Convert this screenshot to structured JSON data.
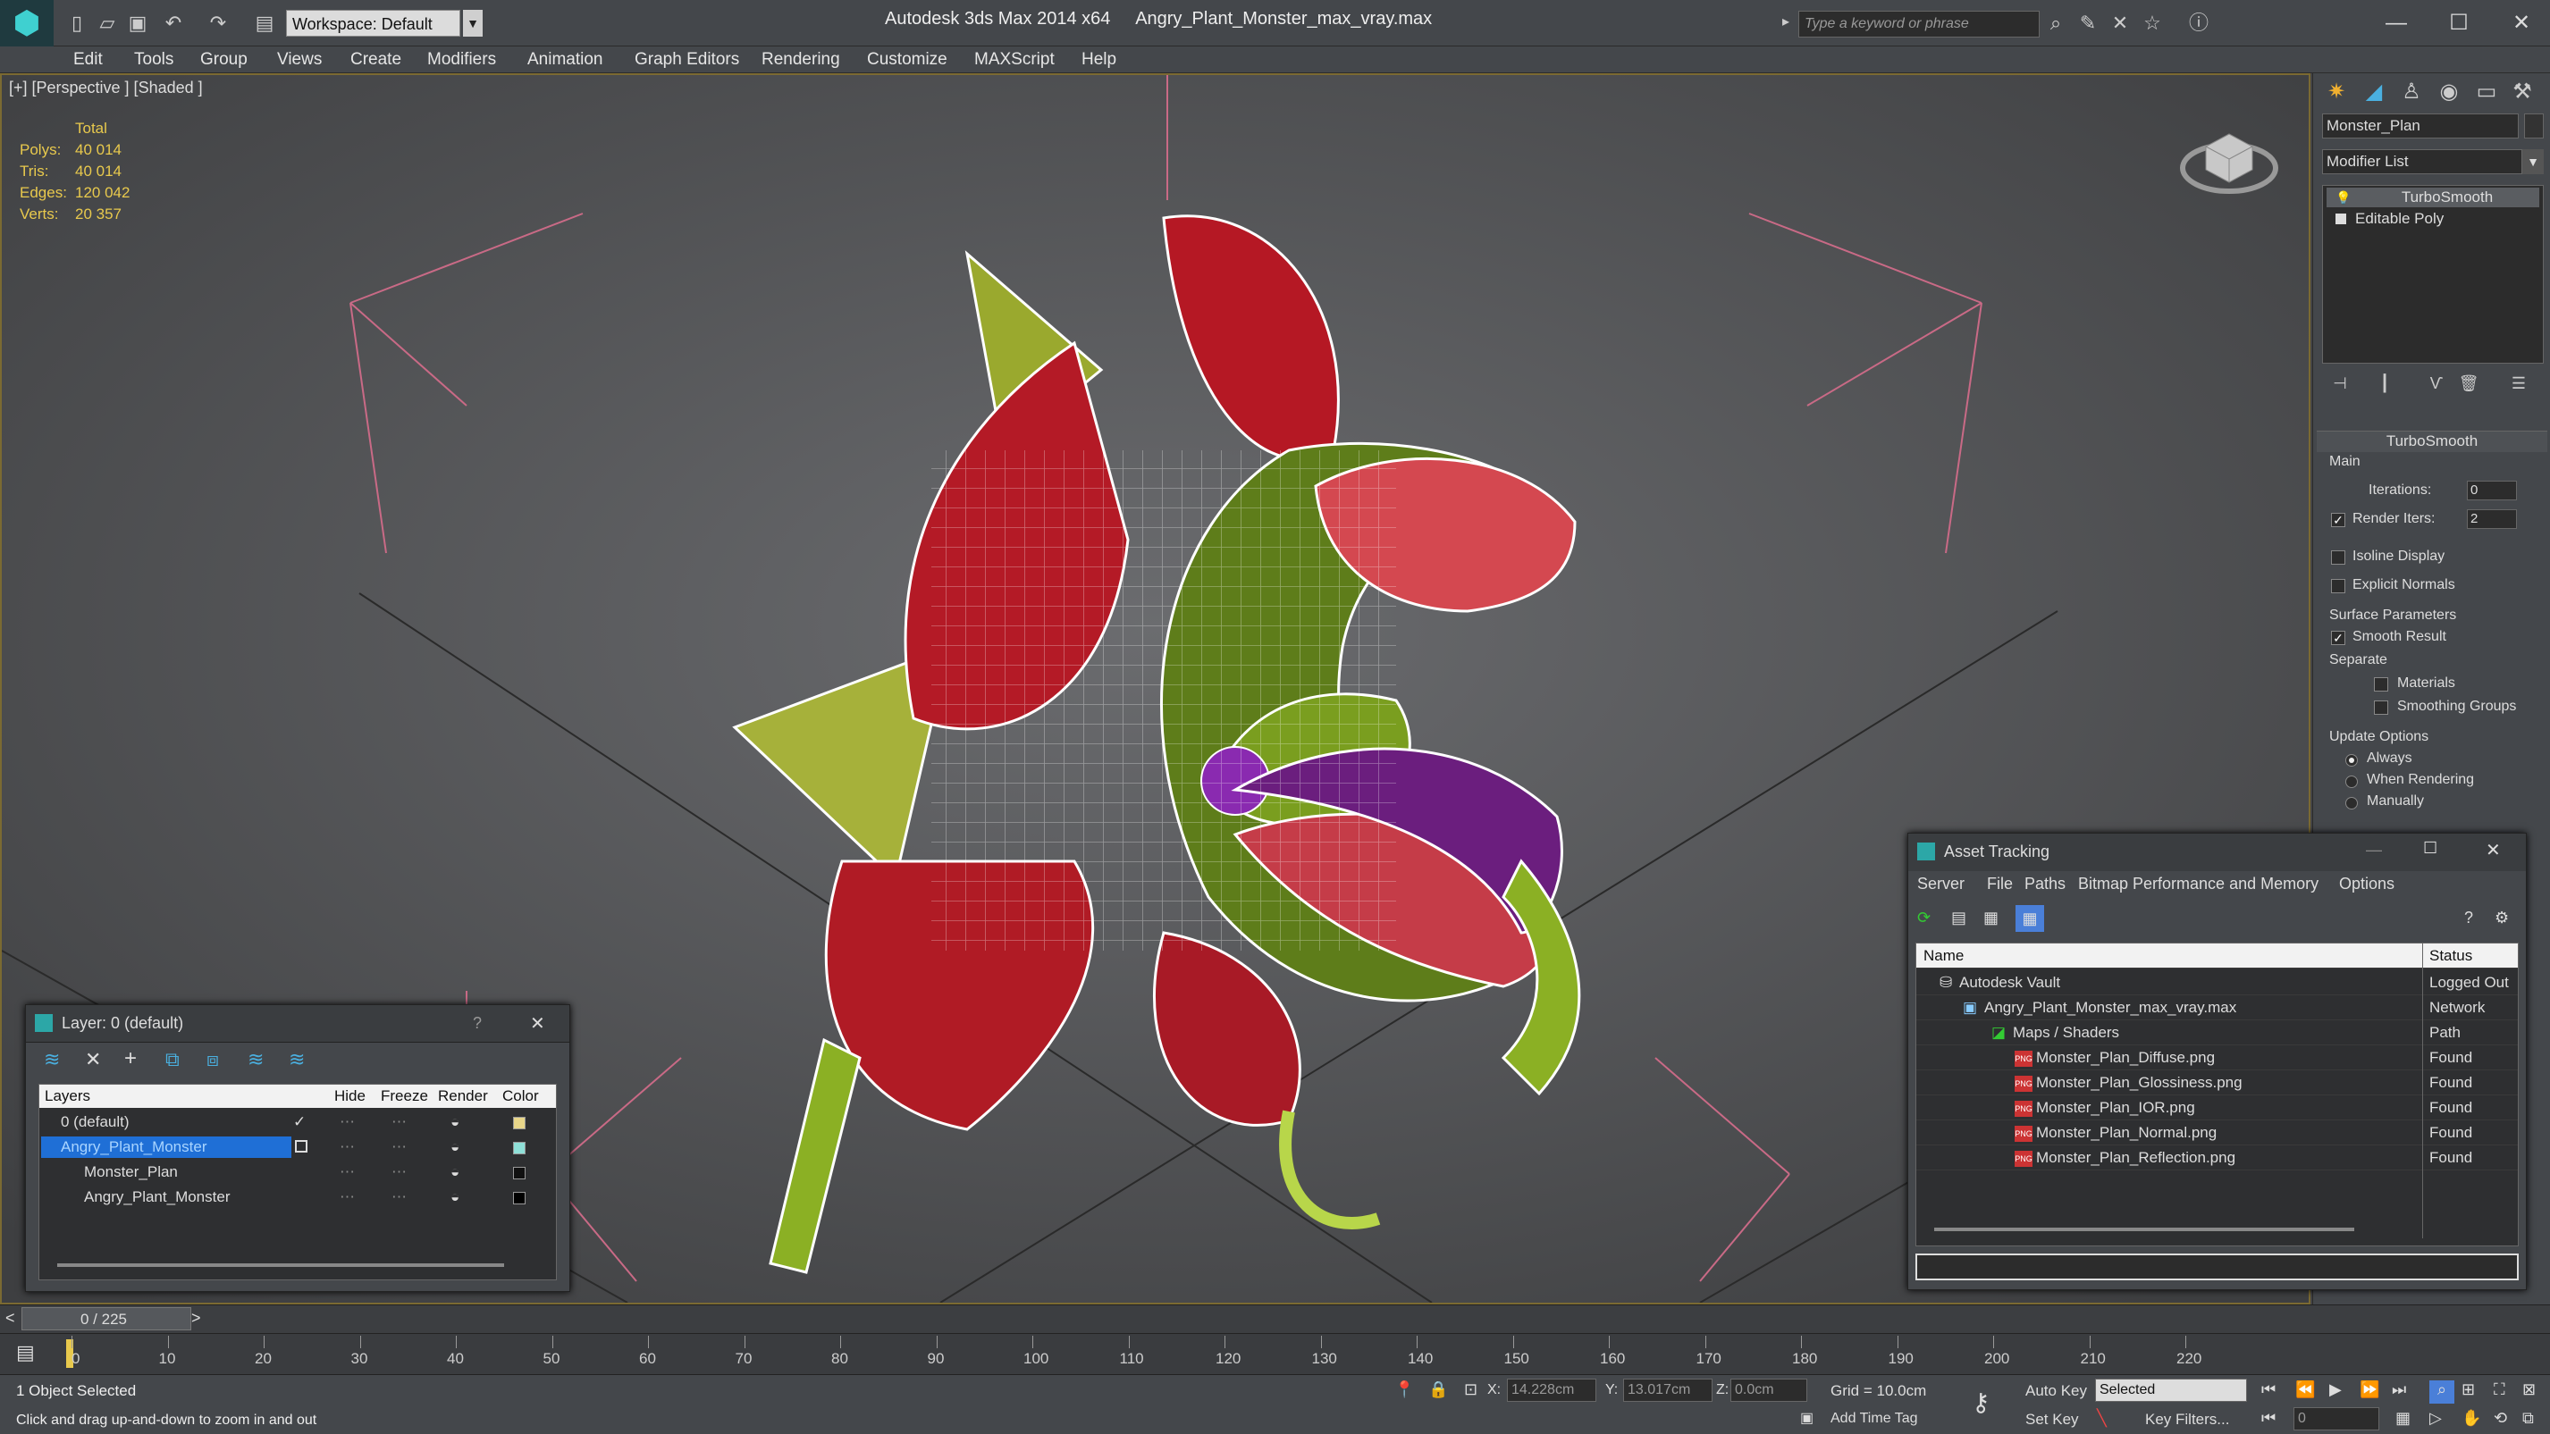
{
  "app": {
    "title": "Autodesk 3ds Max  2014 x64",
    "file": "Angry_Plant_Monster_max_vray.max",
    "workspace": "Workspace: Default",
    "search_placeholder": "Type a keyword or phrase"
  },
  "menu": [
    "Edit",
    "Tools",
    "Group",
    "Views",
    "Create",
    "Modifiers",
    "Animation",
    "Graph Editors",
    "Rendering",
    "Customize",
    "MAXScript",
    "Help"
  ],
  "viewport": {
    "label": "[+] [Perspective ] [Shaded ]",
    "stats": {
      "header": "Total",
      "rows": [
        {
          "k": "Polys:",
          "v": "40 014"
        },
        {
          "k": "Tris:",
          "v": "40 014"
        },
        {
          "k": "Edges:",
          "v": "120 042"
        },
        {
          "k": "Verts:",
          "v": "20 357"
        }
      ]
    }
  },
  "command_panel": {
    "object_name": "Monster_Plan",
    "modifier_list": "Modifier List",
    "stack": [
      "TurboSmooth",
      "Editable Poly"
    ],
    "turbosmooth": {
      "title": "TurboSmooth",
      "main": "Main",
      "iterations_label": "Iterations:",
      "iterations": "0",
      "render_iters_label": "Render Iters:",
      "render_iters": "2",
      "isoline": "Isoline Display",
      "explicit_normals": "Explicit Normals",
      "surface_params": "Surface Parameters",
      "smooth_result": "Smooth Result",
      "separate": "Separate",
      "materials": "Materials",
      "smoothing_groups": "Smoothing Groups",
      "update_options": "Update Options",
      "always": "Always",
      "when_rendering": "When Rendering",
      "manually": "Manually"
    }
  },
  "layer_dialog": {
    "title": "Layer: 0 (default)",
    "help": "?",
    "close": "✕",
    "columns": [
      "Layers",
      "Hide",
      "Freeze",
      "Render",
      "Color"
    ],
    "rows": [
      {
        "name": "0 (default)",
        "color": "#e8d68a"
      },
      {
        "name": "Angry_Plant_Monster",
        "color": "#8fe0d8"
      },
      {
        "name": "Monster_Plan",
        "color": "#111111"
      },
      {
        "name": "Angry_Plant_Monster",
        "color": "#000000"
      }
    ]
  },
  "asset_dialog": {
    "title": "Asset Tracking",
    "menu": [
      "Server",
      "File",
      "Paths",
      "Bitmap Performance and Memory",
      "Options"
    ],
    "col_name": "Name",
    "col_status": "Status",
    "rows": [
      {
        "name": "Autodesk Vault",
        "status": "Logged Out",
        "indent": 1
      },
      {
        "name": "Angry_Plant_Monster_max_vray.max",
        "status": "Network Path",
        "indent": 2
      },
      {
        "name": "Maps / Shaders",
        "status": "",
        "indent": 3
      },
      {
        "name": "Monster_Plan_Diffuse.png",
        "status": "Found",
        "indent": 4
      },
      {
        "name": "Monster_Plan_Glossiness.png",
        "status": "Found",
        "indent": 4
      },
      {
        "name": "Monster_Plan_IOR.png",
        "status": "Found",
        "indent": 4
      },
      {
        "name": "Monster_Plan_Normal.png",
        "status": "Found",
        "indent": 4
      },
      {
        "name": "Monster_Plan_Reflection.png",
        "status": "Found",
        "indent": 4
      }
    ]
  },
  "timeline": {
    "frame": "0 / 225",
    "ticks": [
      "0",
      "10",
      "20",
      "30",
      "40",
      "50",
      "60",
      "70",
      "80",
      "90",
      "100",
      "110",
      "120",
      "130",
      "140",
      "150",
      "160",
      "170",
      "180",
      "190",
      "200",
      "210",
      "220"
    ]
  },
  "status": {
    "selected": "1 Object Selected",
    "hint": "Click and drag up-and-down to zoom in and out",
    "x_label": "X:",
    "x": "14.228cm",
    "y_label": "Y:",
    "y": "13.017cm",
    "z_label": "Z:",
    "z": "0.0cm",
    "grid": "Grid = 10.0cm",
    "auto_key": "Auto Key",
    "selected_mode": "Selected",
    "set_key": "Set Key",
    "key_filters": "Key Filters...",
    "add_time_tag": "Add Time Tag",
    "frame_field": "0"
  }
}
